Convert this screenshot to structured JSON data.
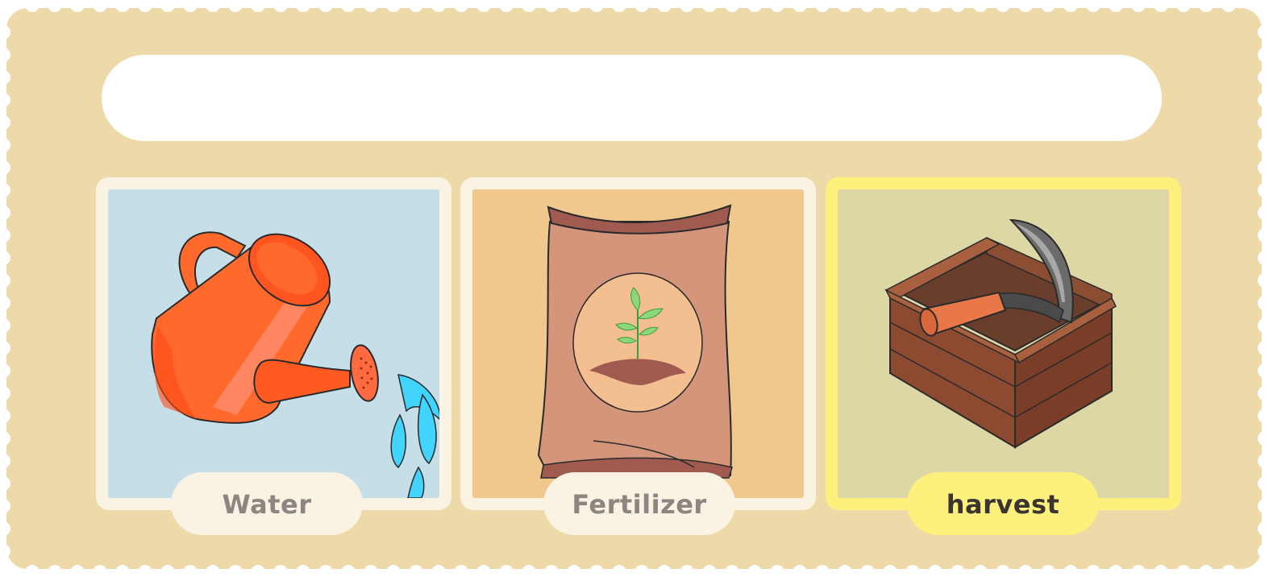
{
  "answer_bar": {
    "text": ""
  },
  "cards": [
    {
      "label": "Water",
      "selected": false,
      "icon": "watering-can-icon"
    },
    {
      "label": "Fertilizer",
      "selected": false,
      "icon": "fertilizer-bag-icon"
    },
    {
      "label": "harvest",
      "selected": true,
      "icon": "harvest-crate-icon"
    }
  ],
  "colors": {
    "board": "#eed9a9",
    "card_border": "#faf3e4",
    "selected_border": "#fdf07d",
    "label_text": "#8b8680",
    "selected_label_text": "#3b3532",
    "water_bg": "#c5dee7",
    "fertilizer_bg": "#f0c88e",
    "harvest_bg": "#dcd7a5"
  }
}
